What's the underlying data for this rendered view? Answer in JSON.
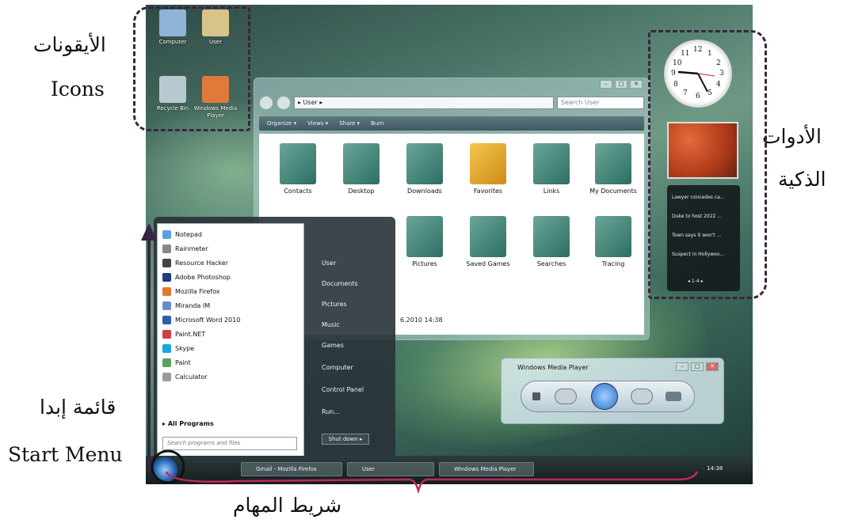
{
  "annotations": {
    "icons_ar": "الأيقونات",
    "icons_en": "Icons",
    "gadgets_ar_1": "الأدوات",
    "gadgets_ar_2": "الذكية",
    "start_ar": "قائمة إبدا",
    "start_en": "Start Menu",
    "taskbar_ar": "شريط المهام"
  },
  "desktop_icons": [
    {
      "label": "Computer",
      "color": "#8fb4d8"
    },
    {
      "label": "User",
      "color": "#d8c48a"
    },
    {
      "label": "Recycle Bin",
      "color": "#b8c8d0"
    },
    {
      "label": "Windows Media Player",
      "color": "#e07a3a"
    }
  ],
  "explorer": {
    "address": "▸ User ▸",
    "search_placeholder": "Search User",
    "toolbar": [
      "Organize ▾",
      "Views ▾",
      "Share ▾",
      "Burn"
    ],
    "folders_row1": [
      "Contacts",
      "Desktop",
      "Downloads",
      "Favorites",
      "Links",
      "My Documents"
    ],
    "folders_row2": [
      "Pictures",
      "Saved Games",
      "Searches",
      "Tracing"
    ],
    "status": "6.2010 14:38"
  },
  "start_menu": {
    "programs": [
      {
        "label": "Notepad",
        "color": "#5aa0d8"
      },
      {
        "label": "Rainmeter",
        "color": "#888888"
      },
      {
        "label": "Resource Hacker",
        "color": "#444444"
      },
      {
        "label": "Adobe Photoshop",
        "color": "#1d3d7a"
      },
      {
        "label": "Mozilla Firefox",
        "color": "#e07a2a"
      },
      {
        "label": "Miranda IM",
        "color": "#6a8acb"
      },
      {
        "label": "Microsoft Word 2010",
        "color": "#2b5fb0"
      },
      {
        "label": "Paint.NET",
        "color": "#d04040"
      },
      {
        "label": "Skype",
        "color": "#19a5e8"
      },
      {
        "label": "Paint",
        "color": "#5aa05a"
      },
      {
        "label": "Calculator",
        "color": "#9a9a9a"
      }
    ],
    "all_programs": "All Programs",
    "search_placeholder": "Search programs and files",
    "right_links": [
      "User",
      "Documents",
      "Pictures",
      "Music",
      "Games",
      "Computer",
      "Control Panel",
      "Run..."
    ],
    "shutdown": "Shut down  ▸"
  },
  "media_player": {
    "title": "Windows Media Player"
  },
  "news_gadget": [
    "Lawyer concedes ca...",
    "Duke to host 2022 ...",
    "Town says it won't ...",
    "Suspect in Hollywoo...",
    "◂  1-4  ▸"
  ],
  "clock_numbers": [
    "12",
    "1",
    "2",
    "3",
    "4",
    "5",
    "6",
    "7",
    "8",
    "9",
    "10",
    "11"
  ],
  "taskbar": {
    "buttons": [
      "Gmail - Mozilla Firefox",
      "User",
      "Windows Media Player"
    ],
    "time": "14:38"
  }
}
